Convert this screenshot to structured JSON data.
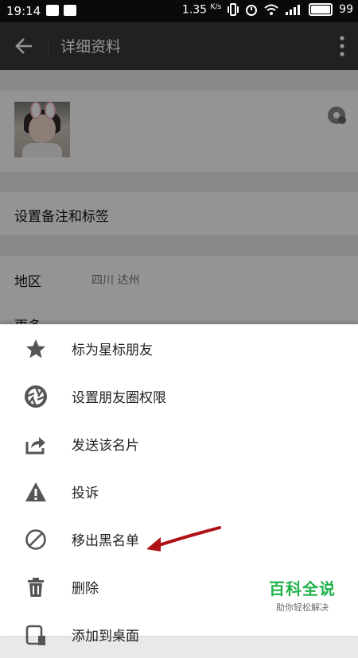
{
  "status_bar": {
    "time": "19:14",
    "speed": "1.35",
    "speed_unit": "K/s",
    "battery": "99"
  },
  "app_bar": {
    "title": "详细资料"
  },
  "profile": {
    "remark_label": "设置备注和标签",
    "region_label": "地区",
    "region_value": "四川  达州",
    "more_label": "更多"
  },
  "menu": {
    "items": [
      {
        "label": "标为星标朋友",
        "icon": "star-icon"
      },
      {
        "label": "设置朋友圈权限",
        "icon": "moments-aperture-icon"
      },
      {
        "label": "发送该名片",
        "icon": "share-icon"
      },
      {
        "label": "投诉",
        "icon": "warning-icon"
      },
      {
        "label": "移出黑名单",
        "icon": "block-icon"
      },
      {
        "label": "删除",
        "icon": "trash-icon"
      },
      {
        "label": "添加到桌面",
        "icon": "add-to-desktop-icon"
      }
    ]
  },
  "watermark": {
    "title": "百科全说",
    "subtitle": "助你轻松解决"
  },
  "colors": {
    "app_bar": "#393a3f",
    "annotation_arrow": "#b01116",
    "watermark": "#21b24c"
  }
}
